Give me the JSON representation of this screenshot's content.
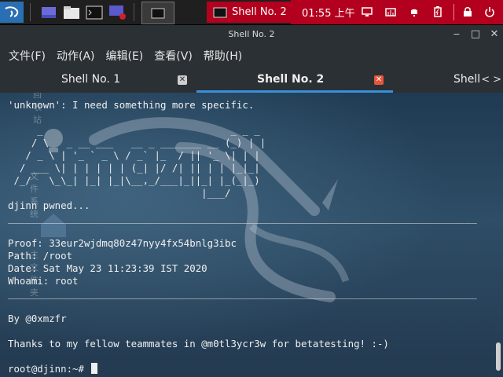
{
  "panel": {
    "task_label": "Shell No. 2",
    "clock": "01:55 上午",
    "colors": {
      "panel_bg": "#1f1f1f",
      "accent": "#b3001e",
      "kali_blue": "#2a6fb3"
    },
    "launcher_icons": [
      "files-icon",
      "folder-icon",
      "terminal-icon",
      "screen-recorder-icon"
    ],
    "tray_icons": [
      "display-icon",
      "network-icon",
      "notification-bell-icon",
      "battery-icon",
      "lock-icon",
      "power-icon"
    ]
  },
  "window": {
    "title": "Shell No. 2",
    "menu": [
      "文件(F)",
      "动作(A)",
      "编辑(E)",
      "查看(V)",
      "帮助(H)"
    ],
    "tabs": [
      {
        "label": "Shell No. 1",
        "active": false
      },
      {
        "label": "Shell No. 2",
        "active": true
      },
      {
        "label": "Shell",
        "active": false
      }
    ],
    "tab_scroll": {
      "left": "<",
      "right": ">"
    }
  },
  "desktop": {
    "labels": [
      "回收站",
      "文件系统",
      "主文件夹"
    ]
  },
  "terminal": {
    "lines": [
      "'unknown': I need something more specific.",
      "",
      "     _                                _ _ _ ",
      "    / \\   _ __ ___   __ _ _______ __ (_) | |",
      "   / _ \\ | '_ ` _ \\ / _` |_  / || '_ \\| | |",
      "  / ___ \\| | | | | | (_| |/ /| || | | |_|_|",
      " /_/   \\_\\_| |_| |_|\\__,_/___|_||_| |_(_|_)",
      "                                 |___/      ",
      "djinn pwned...",
      "________________________________________________________________________________",
      "",
      "Proof: 33eur2wjdmq80z47nyy4fx54bnlg3ibc",
      "Path: /root",
      "Date: Sat May 23 11:23:39 IST 2020",
      "Whoami: root",
      "________________________________________________________________________________",
      "",
      "By @0xmzfr",
      "",
      "Thanks to my fellow teammates in @m0tl3ycr3w for betatesting! :-)",
      "",
      "root@djinn:~# "
    ]
  }
}
